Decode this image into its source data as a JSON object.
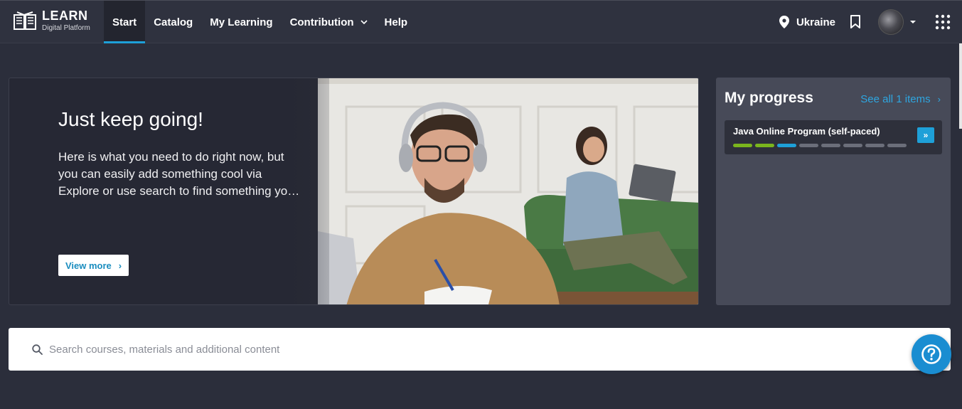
{
  "brand": {
    "title": "LEARN",
    "subtitle": "Digital Platform"
  },
  "nav": {
    "items": [
      {
        "label": "Start",
        "active": true
      },
      {
        "label": "Catalog"
      },
      {
        "label": "My Learning"
      },
      {
        "label": "Contribution",
        "has_dropdown": true
      },
      {
        "label": "Help"
      }
    ]
  },
  "header_tools": {
    "region": "Ukraine",
    "icons": [
      "location-pin-icon",
      "bookmark-icon",
      "avatar",
      "chevron-down-icon",
      "apps-grid-icon"
    ]
  },
  "hero": {
    "title": "Just keep going!",
    "text": "Here is what you need to do right now, but you can easily add something cool via Explore or use search to find something you like",
    "button": "View more",
    "button_arrow": "›"
  },
  "progress": {
    "title": "My progress",
    "see_all": "See all 1 items",
    "see_all_arrow": "›",
    "course": {
      "name": "Java Online Program (self-paced)",
      "go_label": "»",
      "segments": [
        "complete",
        "complete",
        "current",
        "todo",
        "todo",
        "todo",
        "todo",
        "todo"
      ]
    }
  },
  "colors": {
    "complete": "#7ab51d",
    "current": "#1ea0d8",
    "todo": "#6b6e7a",
    "accent": "#1ea0d8"
  },
  "search": {
    "placeholder": "Search courses, materials and additional content"
  },
  "help_fab": {
    "icon": "question-circle-icon"
  }
}
